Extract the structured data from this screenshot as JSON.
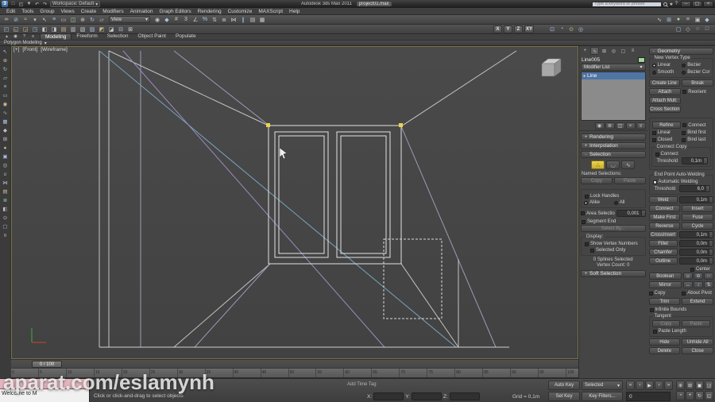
{
  "tb": {
    "app_title": "Autodesk 3ds Max 2011",
    "filename": "project01.max",
    "workspace_label": "Workspace: Default",
    "search_placeholder": "Type a keyword or phrase"
  },
  "menus": [
    "Edit",
    "Tools",
    "Group",
    "Views",
    "Create",
    "Modifiers",
    "Animation",
    "Graph Editors",
    "Rendering",
    "Customize",
    "MAXScript",
    "Help"
  ],
  "toolbar": {
    "coord_system": "View",
    "axis_buttons": [
      "X",
      "Y",
      "Z",
      "XY"
    ]
  },
  "ribbon": {
    "tabs": [
      "Modeling",
      "Freeform",
      "Selection",
      "Object Paint",
      "Populate"
    ],
    "collapsed_section": "Polygon Modeling",
    "caret": "▾"
  },
  "vp": {
    "label_plus": "[+]",
    "label_view": "[Front]",
    "label_shading": "[Wireframe]"
  },
  "cp": {
    "object_name": "Line005",
    "modifier_list_label": "Modifier List",
    "dd_caret": "▾",
    "stack": [
      "Line"
    ],
    "roll": {
      "rendering": {
        "sym": "+",
        "label": "Rendering"
      },
      "interpolation": {
        "sym": "+",
        "label": "Interpolation"
      },
      "selection": {
        "sym": "-",
        "label": "Selection"
      },
      "soft_selection": {
        "sym": "+",
        "label": "Soft Selection"
      },
      "geometry": {
        "sym": "-",
        "label": "Geometry"
      }
    },
    "sel": {
      "named_selections": "Named Selections:",
      "copy": "Copy",
      "paste": "Paste",
      "lock_handles": "Lock Handles",
      "alike": "Alike",
      "all": "All",
      "area_selection": "Area Selection:",
      "area_value": "0,001",
      "segment_end": "Segment End",
      "select_by": "Select By...",
      "display_label": "Display:",
      "show_vertex_numbers": "Show Vertex Numbers",
      "selected_only": "Selected Only",
      "info_line1": "0 Splines Selected",
      "info_line2": "Vertex Count: 0"
    },
    "geo": {
      "new_vertex_type": "New Vertex Type",
      "linear": "Linear",
      "smooth": "Smooth",
      "bezier": "Bezier",
      "bezier_corner": "Bezier Corner",
      "create_line": "Create Line",
      "break_btn": "Break",
      "attach": "Attach",
      "reorient": "Reorient",
      "attach_mult": "Attach Mult.",
      "cross_section": "Cross Section",
      "refine": "Refine",
      "connect_chk": "Connect",
      "linear_chk": "Linear",
      "bind_first": "Bind first",
      "closed": "Closed",
      "bind_last": "Bind last",
      "connect_copy": "Connect Copy",
      "threshold": "Threshold",
      "connect_copy_value": "0,1m",
      "end_point_weld": "End Point Auto-Welding",
      "automatic_welding": "Automatic Welding",
      "weld_threshold_value": "6,0",
      "weld": "Weld",
      "weld_value": "0,1m",
      "connect_btn": "Connect",
      "insert": "Insert",
      "make_first": "Make First",
      "fuse": "Fuse",
      "reverse": "Reverse",
      "cycle": "Cycle",
      "cross_insert": "CrossInsert",
      "cross_insert_value": "0,1m",
      "fillet": "Fillet",
      "fillet_value": "0,0m",
      "chamfer": "Chamfer",
      "chamfer_value": "0,0m",
      "outline": "Outline",
      "outline_value": "0,0m",
      "center": "Center",
      "boolean": "Boolean",
      "mirror": "Mirror",
      "copy_chk": "Copy",
      "about_pivot": "About Pivot",
      "trim": "Trim",
      "extend": "Extend",
      "infinite_bounds": "Infinite Bounds",
      "tangent": "Tangent",
      "tan_copy": "Copy",
      "tan_paste": "Paste",
      "paste_length": "Paste Length",
      "hide": "Hide",
      "unhide_all": "Unhide All",
      "delete_btn": "Delete",
      "close_btn": "Close"
    }
  },
  "tl": {
    "slider_label": "0 / 100",
    "ticks": [
      "0",
      "5",
      "10",
      "15",
      "20",
      "25",
      "30",
      "35",
      "40",
      "45",
      "50",
      "55",
      "60",
      "65",
      "70",
      "75",
      "80",
      "85",
      "90",
      "95",
      "100"
    ]
  },
  "sb": {
    "listener_text": "Welcome to M",
    "status_text": "Click or click-and-drag to select objects",
    "add_time_tag": "Add Time Tag",
    "x_label": "X:",
    "y_label": "Y:",
    "z_label": "Z:",
    "grid_label": "Grid = 0,1m",
    "auto_key": "Auto Key",
    "set_key": "Set Key",
    "selected": "Selected",
    "key_filters": "Key Filters...",
    "frame_value": "0",
    "dd_caret": "▾"
  },
  "watermark": "aparat.com/eslamynh",
  "colors": {
    "accent_yellow": "#ecd64f",
    "selection_blue": "#4f74a6",
    "object_swatch_green": "#9fd49b",
    "listener_pink": "#e3b6bd"
  },
  "icons": {
    "quick_access": [
      {
        "n": "new-scene-icon",
        "g": "□"
      },
      {
        "n": "open-file-icon",
        "g": "◰"
      },
      {
        "n": "save-file-icon",
        "g": "▼"
      },
      {
        "n": "undo-icon",
        "g": "↶"
      },
      {
        "n": "redo-icon",
        "g": "↷"
      }
    ],
    "main_toolbar_left": [
      {
        "n": "select-and-link-icon",
        "g": "∞"
      },
      {
        "n": "unlink-selection-icon",
        "g": "⊘"
      },
      {
        "n": "bind-to-space-warp-icon",
        "g": "≈"
      },
      {
        "n": "selection-filter-dropdown-icon",
        "g": "▾"
      },
      {
        "n": "select-object-icon",
        "g": "↖"
      },
      {
        "n": "select-by-name-icon",
        "g": "≡"
      },
      {
        "n": "rectangular-selection-region-icon",
        "g": "▭"
      },
      {
        "n": "window-crossing-toggle-icon",
        "g": "◫"
      },
      {
        "n": "select-and-move-icon",
        "g": "⊕"
      },
      {
        "n": "select-and-rotate-icon",
        "g": "↻"
      },
      {
        "n": "select-and-scale-icon",
        "g": "▱"
      }
    ],
    "main_toolbar_mid": [
      {
        "n": "use-pivot-point-icon",
        "g": "◉"
      },
      {
        "n": "select-and-manipulate-icon",
        "g": "◆"
      },
      {
        "n": "keyboard-override-icon",
        "g": "#"
      },
      {
        "n": "snaps-toggle-icon",
        "g": "3"
      },
      {
        "n": "angle-snap-icon",
        "g": "∠"
      },
      {
        "n": "percent-snap-icon",
        "g": "%"
      },
      {
        "n": "spinner-snap-icon",
        "g": "⇅"
      },
      {
        "n": "named-selection-sets-icon",
        "g": "≣"
      },
      {
        "n": "mirror-tool-icon",
        "g": "⋈"
      },
      {
        "n": "align-tool-icon",
        "g": "∥"
      },
      {
        "n": "layer-manager-icon",
        "g": "▤"
      },
      {
        "n": "graphite-toggle-icon",
        "g": "▦"
      }
    ],
    "main_toolbar_far": [
      {
        "n": "curve-editor-icon",
        "g": "∿"
      },
      {
        "n": "schematic-view-icon",
        "g": "⊞"
      },
      {
        "n": "material-editor-icon",
        "g": "●"
      },
      {
        "n": "render-setup-icon",
        "g": "¤"
      },
      {
        "n": "rendered-frame-icon",
        "g": "▣"
      },
      {
        "n": "render-production-icon",
        "g": "◆"
      }
    ],
    "toolbar2_left": [
      {
        "n": "toolbar2-icon",
        "g": "◰"
      },
      {
        "n": "toolbar2-icon",
        "g": "◱"
      },
      {
        "n": "toolbar2-icon",
        "g": "◲"
      },
      {
        "n": "toolbar2-icon",
        "g": "◳"
      },
      {
        "n": "toolbar2-icon",
        "g": "◧"
      },
      {
        "n": "toolbar2-icon",
        "g": "◨"
      },
      {
        "n": "toolbar2-icon",
        "g": "▤"
      },
      {
        "n": "toolbar2-icon",
        "g": "▥"
      },
      {
        "n": "toolbar2-icon",
        "g": "▧"
      },
      {
        "n": "toolbar2-icon",
        "g": "▨"
      },
      {
        "n": "toolbar2-icon",
        "g": "◩"
      },
      {
        "n": "toolbar2-icon",
        "g": "◪"
      },
      {
        "n": "toolbar2-icon",
        "g": "⊟"
      },
      {
        "n": "toolbar2-icon",
        "g": "⊠"
      }
    ],
    "toolbar2_mid": [
      {
        "n": "toolbar2-icon",
        "g": "⊡"
      },
      {
        "n": "toolbar2-icon",
        "g": "◔"
      },
      {
        "n": "toolbar2-icon",
        "g": "⊙"
      },
      {
        "n": "toolbar2-icon",
        "g": "◎"
      }
    ],
    "toolbar2_right": [
      {
        "n": "toolbar2-icon",
        "g": "▢"
      },
      {
        "n": "toolbar2-icon",
        "g": "◇"
      },
      {
        "n": "toolbar2-icon",
        "g": "○"
      },
      {
        "n": "toolbar2-icon",
        "g": "□"
      }
    ],
    "ribbon_quick": [
      {
        "n": "ribbon-min-icon",
        "g": "▴"
      },
      {
        "n": "ribbon-pin-icon",
        "g": "◉"
      },
      {
        "n": "ribbon-help-icon",
        "g": "?"
      },
      {
        "n": "ribbon-config-icon",
        "g": "≡"
      }
    ],
    "command_tabs": [
      {
        "n": "create-tab-icon",
        "g": "+"
      },
      {
        "n": "modify-tab-icon",
        "g": "∿"
      },
      {
        "n": "hierarchy-tab-icon",
        "g": "⊞"
      },
      {
        "n": "motion-tab-icon",
        "g": "◎"
      },
      {
        "n": "display-tab-icon",
        "g": "▢"
      },
      {
        "n": "utilities-tab-icon",
        "g": "≡"
      }
    ],
    "stack_tools": [
      {
        "n": "pin-stack-icon",
        "g": "◉"
      },
      {
        "n": "show-end-result-icon",
        "g": "≣"
      },
      {
        "n": "make-unique-icon",
        "g": "◫"
      },
      {
        "n": "remove-modifier-icon",
        "g": "×"
      },
      {
        "n": "configure-modifier-sets-icon",
        "g": "≡"
      }
    ],
    "subobject": [
      {
        "n": "vertex-subobject-icon",
        "g": "∴"
      },
      {
        "n": "segment-subobject-icon",
        "g": "◡"
      },
      {
        "n": "spline-subobject-icon",
        "g": "∿"
      }
    ],
    "boolean": [
      {
        "n": "boolean-union-icon",
        "g": "∪"
      },
      {
        "n": "boolean-subtract-icon",
        "g": "⊖"
      },
      {
        "n": "boolean-intersect-icon",
        "g": "∩"
      }
    ],
    "mirror": [
      {
        "n": "mirror-horizontal-icon",
        "g": "↔"
      },
      {
        "n": "mirror-vertical-icon",
        "g": "↕"
      },
      {
        "n": "mirror-both-icon",
        "g": "⇅"
      }
    ],
    "left_toolbar": [
      {
        "n": "left-toolbar-icon",
        "g": "↖"
      },
      {
        "n": "left-toolbar-icon",
        "g": "⊕"
      },
      {
        "n": "left-toolbar-icon",
        "g": "↻"
      },
      {
        "n": "left-toolbar-icon",
        "g": "▱"
      },
      {
        "n": "left-toolbar-icon",
        "g": "≡"
      },
      {
        "n": "left-toolbar-icon",
        "g": "▭"
      },
      {
        "n": "left-toolbar-icon",
        "g": "◉"
      },
      {
        "n": "left-toolbar-icon",
        "g": "∿"
      },
      {
        "n": "left-toolbar-icon",
        "g": "▦"
      },
      {
        "n": "left-toolbar-icon",
        "g": "◆"
      },
      {
        "n": "left-toolbar-icon",
        "g": "⊞"
      },
      {
        "n": "left-toolbar-icon",
        "g": "●"
      },
      {
        "n": "left-toolbar-icon",
        "g": "▣"
      },
      {
        "n": "left-toolbar-icon",
        "g": "◎"
      },
      {
        "n": "left-toolbar-icon",
        "g": "∪"
      },
      {
        "n": "left-toolbar-icon",
        "g": "⋈"
      },
      {
        "n": "left-toolbar-icon",
        "g": "▤"
      },
      {
        "n": "left-toolbar-icon",
        "g": "≣"
      },
      {
        "n": "left-toolbar-icon",
        "g": "◧"
      },
      {
        "n": "left-toolbar-icon",
        "g": "⊙"
      },
      {
        "n": "left-toolbar-icon",
        "g": "▢"
      },
      {
        "n": "left-toolbar-icon",
        "g": "¤"
      }
    ],
    "transport": [
      {
        "n": "go-to-start-icon",
        "g": "«"
      },
      {
        "n": "previous-frame-icon",
        "g": "‹"
      },
      {
        "n": "play-animation-icon",
        "g": "▶"
      },
      {
        "n": "next-frame-icon",
        "g": "›"
      },
      {
        "n": "go-to-end-icon",
        "g": "»"
      }
    ],
    "viewport_nav": [
      {
        "n": "zoom-icon",
        "g": "⊕"
      },
      {
        "n": "zoom-all-icon",
        "g": "⊞"
      },
      {
        "n": "zoom-extents-icon",
        "g": "▣"
      },
      {
        "n": "zoom-extents-all-icon",
        "g": "◲"
      },
      {
        "n": "field-of-view-icon",
        "g": "◔"
      },
      {
        "n": "pan-view-icon",
        "g": "+"
      },
      {
        "n": "orbit-view-icon",
        "g": "↻"
      },
      {
        "n": "maximize-viewport-toggle-icon",
        "g": "◱"
      }
    ]
  }
}
